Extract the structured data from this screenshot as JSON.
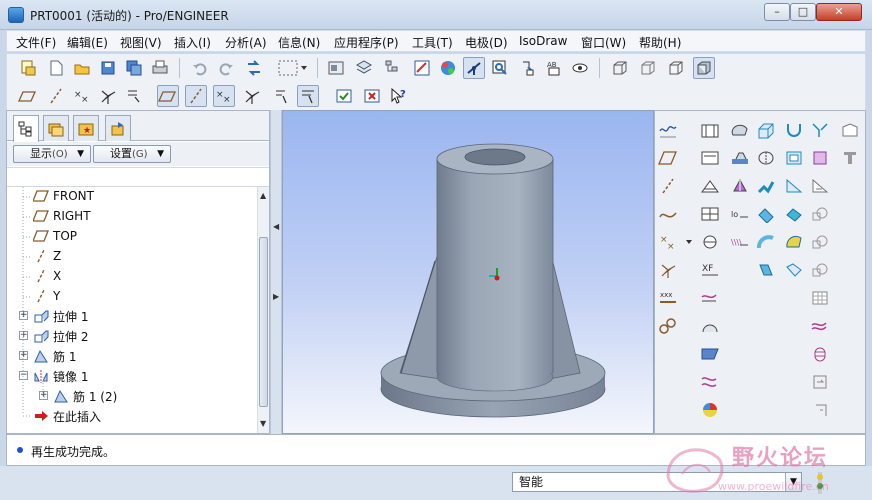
{
  "window": {
    "title": "PRT0001 (活动的) - Pro/ENGINEER",
    "minimize": "–",
    "maximize": "□",
    "close": "✕"
  },
  "menubar": {
    "items": [
      "文件(F)",
      "编辑(E)",
      "视图(V)",
      "插入(I)",
      "分析(A)",
      "信息(N)",
      "应用程序(P)",
      "工具(T)",
      "电极(D)",
      "IsoDraw",
      "窗口(W)",
      "帮助(H)"
    ]
  },
  "model_tree": {
    "display_button": "显示",
    "display_shortcut": "(O)",
    "settings_button": "设置",
    "settings_shortcut": "(G)",
    "items": [
      {
        "label": "FRONT",
        "icon": "datum-plane-icon"
      },
      {
        "label": "RIGHT",
        "icon": "datum-plane-icon"
      },
      {
        "label": "TOP",
        "icon": "datum-plane-icon"
      },
      {
        "label": "Z",
        "icon": "datum-axis-icon"
      },
      {
        "label": "X",
        "icon": "datum-axis-icon"
      },
      {
        "label": "Y",
        "icon": "datum-axis-icon"
      },
      {
        "label": "拉伸 1",
        "icon": "extrude-icon"
      },
      {
        "label": "拉伸 2",
        "icon": "extrude-icon"
      },
      {
        "label": "筋 1",
        "icon": "rib-icon"
      },
      {
        "label": "镜像 1",
        "icon": "mirror-icon"
      },
      {
        "label": "筋 1 (2)",
        "icon": "rib-icon"
      },
      {
        "label": "在此插入",
        "icon": "insert-here-arrow-icon"
      }
    ]
  },
  "status": {
    "message": "再生成功完成。"
  },
  "bottom": {
    "filter_value": "智能"
  },
  "watermark": {
    "text": "野火论坛",
    "url_text": "www.proewildfire.cn"
  },
  "colors": {
    "model_gray": "#8a97a8",
    "viewport_top": "#9ab6f0",
    "viewport_bottom": "#f4f6fb",
    "watermark_pink": "#e07aa8"
  }
}
